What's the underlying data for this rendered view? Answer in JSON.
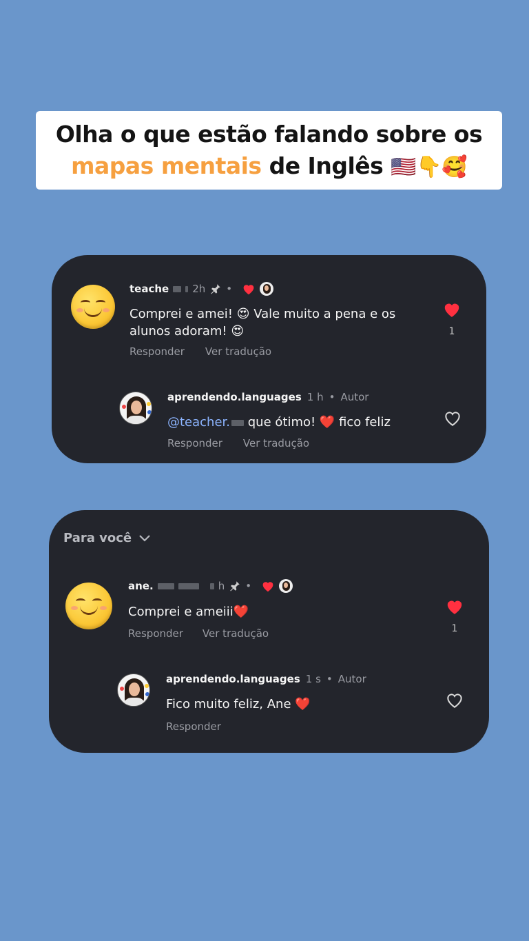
{
  "headline": {
    "line1": "Olha o que estão falando sobre os",
    "highlight": "mapas mentais",
    "line2_rest": " de Inglês ",
    "emojis": "🇺🇸👇🥰"
  },
  "colors": {
    "background": "#6a96cb",
    "card": "#23252c",
    "accent_orange": "#f6a040",
    "heart_red": "#ff3040",
    "mention_blue": "#8cb4ff"
  },
  "card1": {
    "comment": {
      "username": "teache",
      "time": "2h",
      "text": "Comprei e amei! 😍 Vale muito a pena e os alunos adoram! 😍",
      "reply_label": "Responder",
      "translate_label": "Ver tradução",
      "like_count": "1",
      "icons": [
        "smiley-avatar",
        "pin-icon",
        "heart-filled-icon",
        "heart-liked-icon"
      ]
    },
    "reply": {
      "username": "aprendendo.languages",
      "time": "1 h",
      "author_badge": "Autor",
      "mention": "@teacher.",
      "text": " que ótimo! ❤️ fico feliz",
      "reply_label": "Responder",
      "translate_label": "Ver tradução",
      "icons": [
        "heart-outline-icon"
      ]
    }
  },
  "card2": {
    "section_title": "Para você",
    "comment": {
      "username": "ane.",
      "time": "h",
      "text": "Comprei e ameiii❤️",
      "reply_label": "Responder",
      "translate_label": "Ver tradução",
      "like_count": "1"
    },
    "reply": {
      "username": "aprendendo.languages",
      "time": "1 s",
      "author_badge": "Autor",
      "text": "Fico muito feliz, Ane ❤️",
      "reply_label": "Responder"
    }
  }
}
